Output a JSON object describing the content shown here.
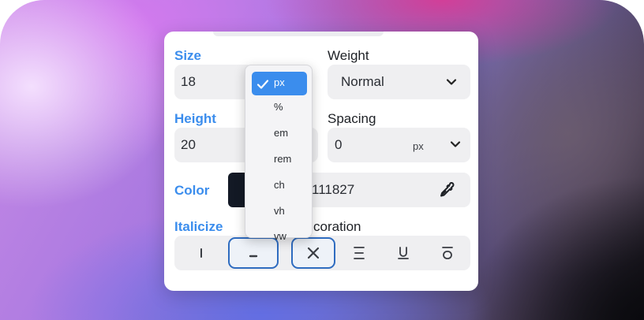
{
  "panel": {
    "size_label": "Size",
    "size_value": "18",
    "weight_label": "Weight",
    "weight_value": "Normal",
    "height_label": "Height",
    "height_value": "20",
    "spacing_label": "Spacing",
    "spacing_value": "0",
    "spacing_unit": "px",
    "color_label": "Color",
    "color_hex": "111827",
    "color_swatch": "#131925",
    "italicize_label": "Italicize",
    "decoration_label_visible": "coration",
    "accent_color": "#3b8ded"
  },
  "unit_menu": {
    "options": [
      "px",
      "%",
      "em",
      "rem",
      "ch",
      "vh",
      "vw"
    ],
    "selected": "px"
  },
  "icons": {
    "italic": "italic-icon",
    "bold": "bold-icon",
    "none": "close-icon",
    "line_through": "strikethrough-icon",
    "underline": "underline-icon",
    "overline": "overline-icon",
    "eyedropper": "eyedropper-icon",
    "chevron": "chevron-down-icon",
    "check": "checkmark-icon"
  }
}
